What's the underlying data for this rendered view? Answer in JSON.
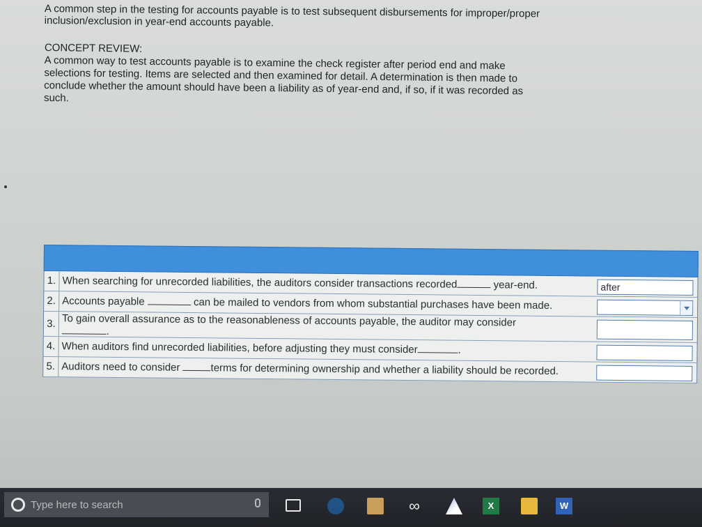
{
  "intro": {
    "line1": "A common step in the testing for accounts payable is to test subsequent disbursements for improper/proper",
    "line2": "inclusion/exclusion in year-end accounts payable."
  },
  "concept": {
    "heading": "CONCEPT REVIEW:",
    "l1": "A common way to test accounts payable is to examine the check register after period end and make",
    "l2": "selections for testing. Items are selected and then examined for detail. A determination is then made to",
    "l3": "conclude whether the amount should have been a liability as of year-end and, if so, if it was recorded as",
    "l4": "such."
  },
  "questions": [
    {
      "num": "1.",
      "pre": "When searching for unrecorded liabilities, the auditors consider transactions recorded",
      "post": "year-end.",
      "answer": "after"
    },
    {
      "num": "2.",
      "pre": "Accounts payable",
      "post": "can be mailed to vendors from whom substantial purchases have been made.",
      "answer": ""
    },
    {
      "num": "3.",
      "pre": "To gain overall assurance as to the reasonableness of accounts payable, the auditor may consider",
      "post": ".",
      "answer": ""
    },
    {
      "num": "4.",
      "pre": "When auditors find unrecorded liabilities, before adjusting they must consider",
      "post": ".",
      "answer": ""
    },
    {
      "num": "5.",
      "pre": "Auditors need to consider",
      "post": "terms for determining ownership and whether a liability should be recorded.",
      "answer": ""
    }
  ],
  "taskbar": {
    "search_placeholder": "Type here to search",
    "excel_letter": "X",
    "word_letter": "W",
    "infinity": "∞"
  },
  "colors": {
    "header_blue": "#3f8fdc",
    "answer_border": "#4a7bb8"
  }
}
